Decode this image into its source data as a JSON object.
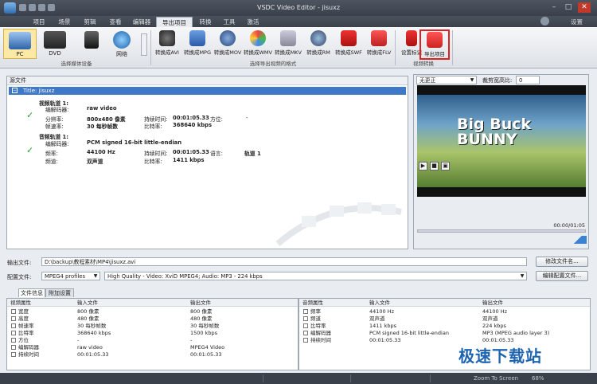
{
  "window": {
    "title": "VSDC Video Editor - jisuxz"
  },
  "menu": {
    "tabs": [
      "项目",
      "场景",
      "剪辑",
      "查看",
      "编辑器",
      "导出项目",
      "转换",
      "工具",
      "激活"
    ],
    "active": "导出项目",
    "settings": "设置"
  },
  "ribbon": {
    "devices": [
      "PC",
      "DVD",
      "网络"
    ],
    "device_group": "选择媒体设备",
    "formats": [
      "转换成AVI",
      "转换成MPG",
      "转换成MOV",
      "转换成WMV",
      "转换成MKV",
      "转换成RM",
      "转换成SWF",
      "转换成FLV"
    ],
    "format_group": "选择导出视频的格式",
    "actions": [
      "设置标记",
      "导出项目"
    ],
    "action_group": "视频转换"
  },
  "source": {
    "header": "源文件",
    "title_item": "Title: jisuxz",
    "video_track": "视频轨道 1:",
    "codec_label": "编解码器:",
    "video_codec": "raw video",
    "resolution_label": "分辨率:",
    "resolution": "800x480 像素",
    "fps_label": "帧速率:",
    "fps": "30 每秒帧数",
    "duration_label": "持续时间:",
    "duration": "00:01:05.33",
    "orientation_label": "方位:",
    "orientation": "-",
    "bitrate_label": "比特率:",
    "video_bitrate": "368640 kbps",
    "audio_track": "音频轨道 1:",
    "audio_codec": "PCM signed 16-bit little-endian",
    "freq_label": "频率:",
    "freq": "44100 Hz",
    "channel_label": "频道:",
    "channel": "双声道",
    "audio_duration": "00:01:05.33",
    "lang_label": "语言:",
    "lang": "轨道 1",
    "audio_bitrate": "1411 kbps"
  },
  "preview": {
    "mode": "无更正",
    "crop_label": "裁剪宽高比:",
    "crop_value": "0",
    "title_line1": "Big Buck",
    "title_line2": "BUNNY",
    "time": "00:00/01:05"
  },
  "output": {
    "label": "输出文件:",
    "path": "D:\\backup\\教程素材\\MP4\\jisuxz.avi",
    "change_button": "修改文件名...",
    "profile_label": "配置文件:",
    "profile": "MPEG4 profiles",
    "quality": "High Quality - Video: XviD MPEG4; Audio: MP3 - 224 kbps",
    "edit_button": "编辑配置文件..."
  },
  "tabs": [
    "文件信息",
    "附加设置"
  ],
  "video_props": {
    "headers": [
      "视频属性",
      "输入文件",
      "输出文件"
    ],
    "rows": [
      [
        "宽度",
        "800 像素",
        "800 像素"
      ],
      [
        "高度",
        "480 像素",
        "480 像素"
      ],
      [
        "帧速率",
        "30 每秒帧数",
        "30 每秒帧数"
      ],
      [
        "比特率",
        "368640 kbps",
        "1500 kbps"
      ],
      [
        "方位",
        "-",
        "-"
      ],
      [
        "编解码器",
        "raw video",
        "MPEG4 Video"
      ],
      [
        "持续时间",
        "00:01:05.33",
        "00:01:05.33"
      ]
    ]
  },
  "audio_props": {
    "headers": [
      "音频属性",
      "输入文件",
      "输出文件"
    ],
    "rows": [
      [
        "频率",
        "44100 Hz",
        "44100 Hz"
      ],
      [
        "频道",
        "双声道",
        "双声道"
      ],
      [
        "比特率",
        "1411 kbps",
        "224 kbps"
      ],
      [
        "编解码器",
        "PCM signed 16-bit little-endian",
        "MP3 (MPEG audio layer 3)"
      ],
      [
        "持续时间",
        "00:01:05.33",
        "00:01:05.33"
      ]
    ]
  },
  "status": {
    "zoom": "Zoom To Screen",
    "zoom_pct": "68%"
  },
  "watermark": "极速下载站"
}
